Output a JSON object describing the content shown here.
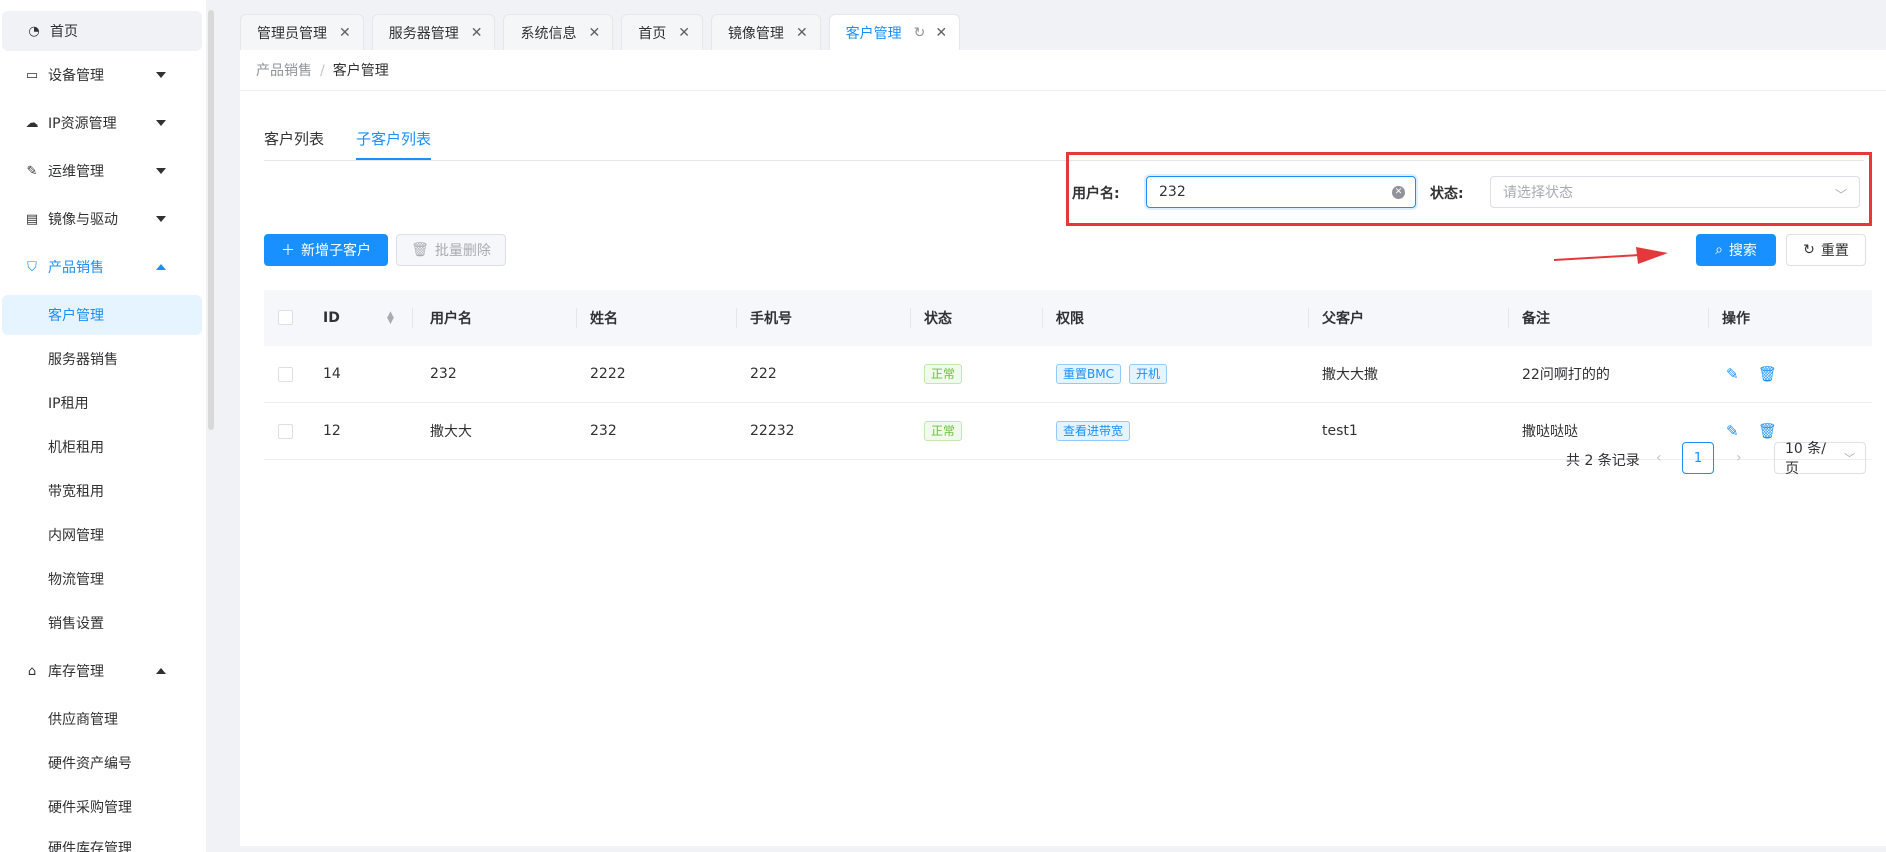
{
  "sidebar": {
    "items": [
      {
        "label": "首页",
        "icon": "dashboard-icon"
      },
      {
        "label": "设备管理",
        "icon": "laptop-icon"
      },
      {
        "label": "IP资源管理",
        "icon": "cloud-icon"
      },
      {
        "label": "运维管理",
        "icon": "wrench-icon"
      },
      {
        "label": "镜像与驱动",
        "icon": "disk-icon"
      },
      {
        "label": "产品销售",
        "icon": "shopping-bag-icon"
      },
      {
        "label": "库存管理",
        "icon": "bank-icon"
      }
    ],
    "product_sales_children": [
      "客户管理",
      "服务器销售",
      "IP租用",
      "机柜租用",
      "带宽租用",
      "内网管理",
      "物流管理",
      "销售设置"
    ],
    "inventory_children": [
      "供应商管理",
      "硬件资产编号",
      "硬件采购管理",
      "硬件库存管理"
    ]
  },
  "tabs": [
    {
      "label": "管理员管理"
    },
    {
      "label": "服务器管理"
    },
    {
      "label": "系统信息"
    },
    {
      "label": "首页"
    },
    {
      "label": "镜像管理"
    },
    {
      "label": "客户管理",
      "active": true
    }
  ],
  "breadcrumb": {
    "parent": "产品销售",
    "separator": "/",
    "current": "客户管理"
  },
  "inner_tabs": [
    "客户列表",
    "子客户列表"
  ],
  "search": {
    "username_label": "用户名:",
    "username_value": "232",
    "status_label": "状态:",
    "status_placeholder": "请选择状态",
    "search_button": "搜索",
    "reset_button": "重置"
  },
  "actions": {
    "add_button": "新增子客户",
    "batch_delete_button": "批量删除"
  },
  "table": {
    "headers": [
      "ID",
      "用户名",
      "姓名",
      "手机号",
      "状态",
      "权限",
      "父客户",
      "备注",
      "操作"
    ],
    "rows": [
      {
        "id": "14",
        "username": "232",
        "name": "2222",
        "phone": "222",
        "status": "正常",
        "permissions": [
          "重置BMC",
          "开机"
        ],
        "parent": "撒大大撒",
        "remark": "22问啊打的的"
      },
      {
        "id": "12",
        "username": "撒大大",
        "name": "232",
        "phone": "22232",
        "status": "正常",
        "permissions": [
          "查看进带宽"
        ],
        "parent": "test1",
        "remark": "撒哒哒哒"
      }
    ]
  },
  "pagination": {
    "total": "共 2 条记录",
    "current_page": "1",
    "page_size": "10 条/页"
  },
  "colors": {
    "primary": "#1890ff",
    "highlight": "#e5383b",
    "success": "#67c23a"
  }
}
